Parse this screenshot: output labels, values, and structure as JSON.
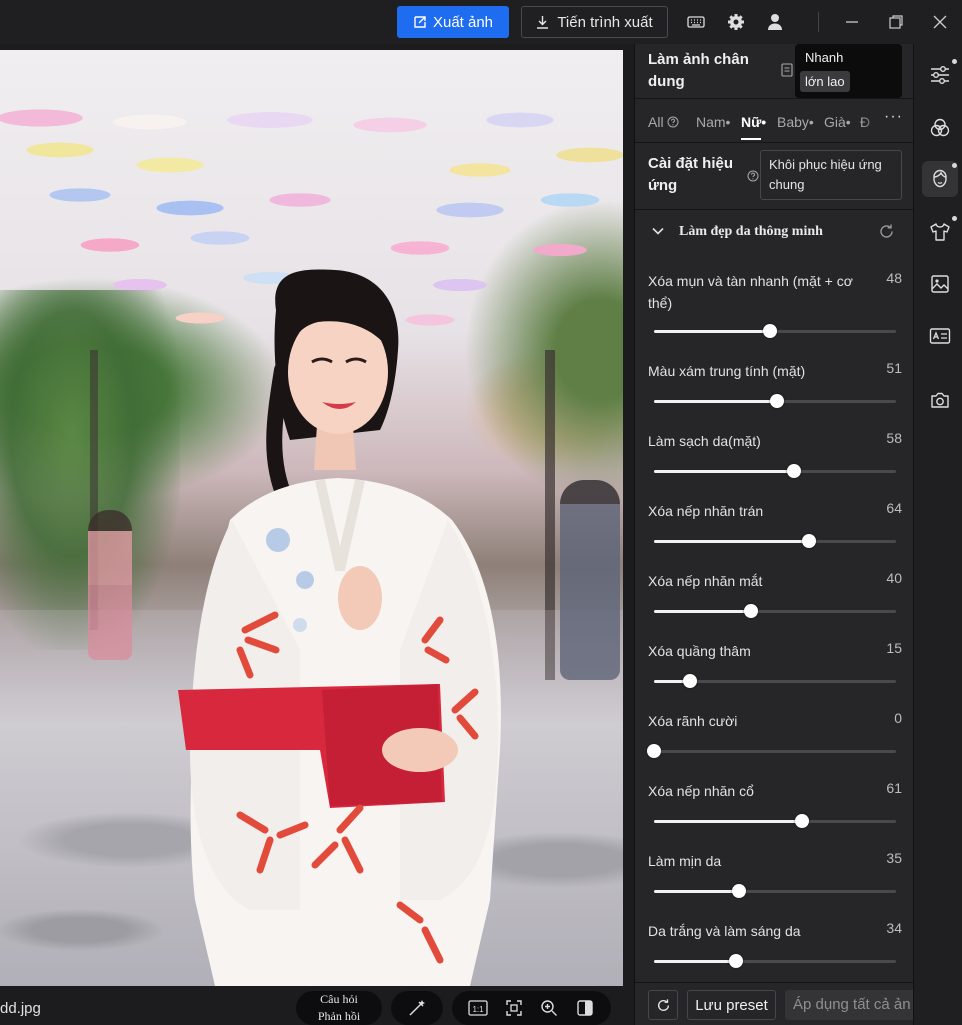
{
  "topbar": {
    "export_label": "Xuất ảnh",
    "progress_label": "Tiến trình xuất",
    "icons": [
      "keyboard-icon",
      "gear-icon",
      "user-icon",
      "minimize-icon",
      "restore-icon",
      "close-icon"
    ]
  },
  "photo": {
    "filename": "dd.jpg"
  },
  "bottombar": {
    "feedback_line1": "Câu hỏi",
    "feedback_line2": "Phản hồi",
    "zoom_1to1": "1:1"
  },
  "panel": {
    "preset_title": "Làm ảnh chân dung",
    "mode_popup": {
      "option1": "Nhanh",
      "option2": "lớn lao"
    },
    "tabs": [
      {
        "label": "All",
        "active": false
      },
      {
        "label": "Nam•",
        "active": false
      },
      {
        "label": "Nữ•",
        "active": true
      },
      {
        "label": "Baby•",
        "active": false
      },
      {
        "label": "Già•",
        "active": false
      },
      {
        "label": "Đ",
        "active": false
      }
    ],
    "tab_more": "···",
    "effect_title": "Cài đặt hiệu ứng",
    "reset_effect": "Khôi phục hiệu ứng chung",
    "section_title": "Làm đẹp da thông minh",
    "sliders": [
      {
        "label": "Xóa mụn và tàn nhanh (mặt + cơ thể)",
        "value": 48
      },
      {
        "label": "Màu xám trung tính (mặt)",
        "value": 51
      },
      {
        "label": "Làm sạch da(mặt)",
        "value": 58
      },
      {
        "label": "Xóa nếp nhăn trán",
        "value": 64
      },
      {
        "label": "Xóa nếp nhăn mắt",
        "value": 40
      },
      {
        "label": "Xóa quầng thâm",
        "value": 15
      },
      {
        "label": "Xóa rãnh cười",
        "value": 0
      },
      {
        "label": "Xóa nếp nhăn cổ",
        "value": 61
      },
      {
        "label": "Làm mịn da",
        "value": 35
      },
      {
        "label": "Da trắng và làm sáng da",
        "value": 34
      }
    ],
    "save_preset": "Lưu preset",
    "apply_all": "Áp dụng tất cả ản"
  },
  "rail": {
    "icons": [
      "adjust-sliders-icon",
      "color-circles-icon",
      "face-retouch-icon",
      "clothing-icon",
      "image-icon",
      "id-card-icon",
      "camera-icon"
    ]
  },
  "colors": {
    "accent": "#1e6cf0",
    "panel_bg": "#262628",
    "sash_red": "#d8283e"
  }
}
